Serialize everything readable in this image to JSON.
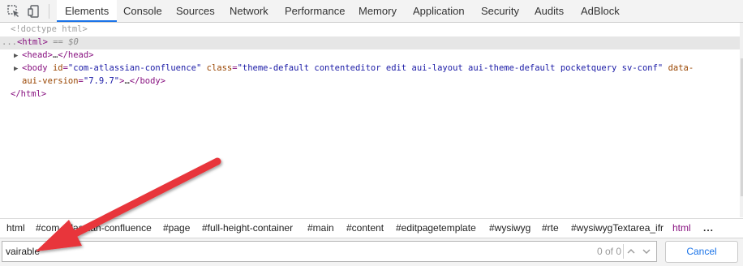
{
  "toolbar": {
    "icons": [
      "inspect-element-icon",
      "device-toolbar-icon"
    ],
    "tabs": [
      {
        "label": "Elements",
        "active": true
      },
      {
        "label": "Console"
      },
      {
        "label": "Sources"
      },
      {
        "label": "Network"
      },
      {
        "label": "Performance"
      },
      {
        "label": "Memory"
      },
      {
        "label": "Application"
      },
      {
        "label": "Security"
      },
      {
        "label": "Audits"
      },
      {
        "label": "AdBlock"
      }
    ]
  },
  "tree": {
    "doctype": "<!doctype html>",
    "html_open": {
      "dots": "...",
      "tag": "<html>",
      "eq": " == ",
      "ref": "$0"
    },
    "head": {
      "arrow": "▶",
      "open": "<head>",
      "ellipsis": "…",
      "close": "</head>"
    },
    "body": {
      "arrow": "▶",
      "tag_start": "<body ",
      "attr_id": "id",
      "eq": "=",
      "val_id": "\"com-atlassian-confluence\"",
      "attr_class": " class",
      "val_class": "\"theme-default contenteditor edit aui-layout aui-theme-default pocketquery sv-conf\"",
      "attr_data_part1": " data-",
      "attr_data_part2": "aui-version",
      "val_data": "\"7.9.7\"",
      "tag_end": ">",
      "ellipsis": "…",
      "close": "</body>"
    },
    "html_close": "</html>"
  },
  "breadcrumbs": [
    "html",
    "#com-atlassian-confluence",
    "#page",
    "#full-height-container",
    "#main",
    "#content",
    "#editpagetemplate",
    "#wysiwyg",
    "#rte",
    "#wysiwygTextarea_ifr",
    "html",
    "..."
  ],
  "search": {
    "value": "vairable",
    "match_count": "0 of 0",
    "cancel_label": "Cancel"
  },
  "colors": {
    "active_tab": "#1a73e8",
    "tag": "#881280",
    "attribute": "#994500",
    "value": "#1a1aa6",
    "annotation_arrow": "#e8343a"
  }
}
